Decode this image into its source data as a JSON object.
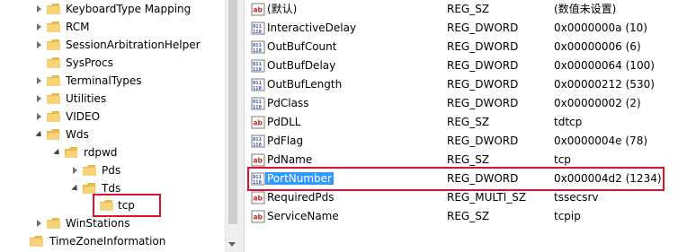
{
  "tree": {
    "items": [
      {
        "label": "KeyboardType Mapping",
        "expander": "collapsed"
      },
      {
        "label": "RCM",
        "expander": "collapsed"
      },
      {
        "label": "SessionArbitrationHelper",
        "expander": "collapsed"
      },
      {
        "label": "SysProcs",
        "expander": "none"
      },
      {
        "label": "TerminalTypes",
        "expander": "collapsed"
      },
      {
        "label": "Utilities",
        "expander": "collapsed"
      },
      {
        "label": "VIDEO",
        "expander": "collapsed"
      },
      {
        "label": "Wds",
        "expander": "expanded"
      },
      {
        "label": "rdpwd",
        "expander": "expanded"
      },
      {
        "label": "Pds",
        "expander": "collapsed"
      },
      {
        "label": "Tds",
        "expander": "expanded"
      },
      {
        "label": "tcp",
        "expander": "none",
        "selected": true
      },
      {
        "label": "WinStations",
        "expander": "collapsed"
      },
      {
        "label": "TimeZoneInformation",
        "expander": "none"
      }
    ]
  },
  "values": {
    "rows": [
      {
        "name": "(默认)",
        "icon": "string-value-icon",
        "type": "REG_SZ",
        "data": "(数值未设置)"
      },
      {
        "name": "InteractiveDelay",
        "icon": "binary-value-icon",
        "type": "REG_DWORD",
        "data": "0x0000000a (10)"
      },
      {
        "name": "OutBufCount",
        "icon": "binary-value-icon",
        "type": "REG_DWORD",
        "data": "0x00000006 (6)"
      },
      {
        "name": "OutBufDelay",
        "icon": "binary-value-icon",
        "type": "REG_DWORD",
        "data": "0x00000064 (100)"
      },
      {
        "name": "OutBufLength",
        "icon": "binary-value-icon",
        "type": "REG_DWORD",
        "data": "0x00000212 (530)"
      },
      {
        "name": "PdClass",
        "icon": "binary-value-icon",
        "type": "REG_DWORD",
        "data": "0x00000002 (2)"
      },
      {
        "name": "PdDLL",
        "icon": "string-value-icon",
        "type": "REG_SZ",
        "data": "tdtcp"
      },
      {
        "name": "PdFlag",
        "icon": "binary-value-icon",
        "type": "REG_DWORD",
        "data": "0x0000004e (78)"
      },
      {
        "name": "PdName",
        "icon": "string-value-icon",
        "type": "REG_SZ",
        "data": "tcp"
      },
      {
        "name": "PortNumber",
        "icon": "binary-value-icon",
        "type": "REG_DWORD",
        "data": "0x000004d2 (1234)",
        "selected": true
      },
      {
        "name": "RequiredPds",
        "icon": "string-value-icon",
        "type": "REG_MULTI_SZ",
        "data": "tssecsrv"
      },
      {
        "name": "ServiceName",
        "icon": "string-value-icon",
        "type": "REG_SZ",
        "data": "tcpip"
      }
    ]
  },
  "colors": {
    "highlight": "#e0102a",
    "selection": "#3399ff",
    "folder": "#f2c65a"
  }
}
